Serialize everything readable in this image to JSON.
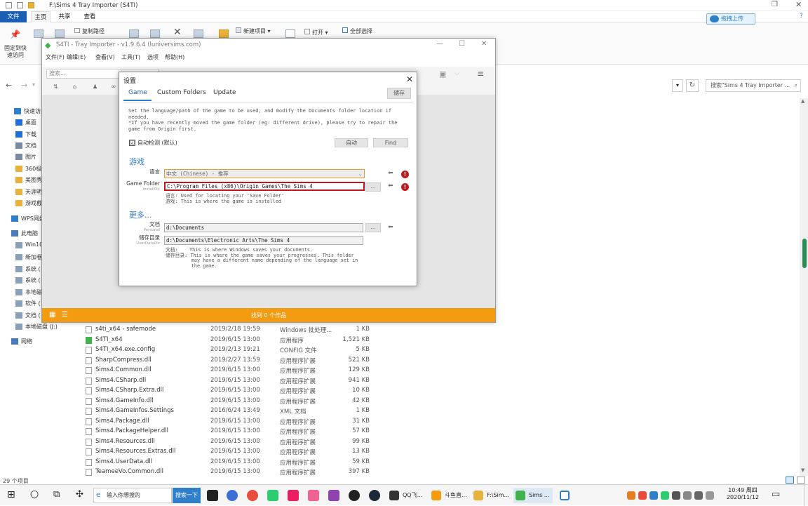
{
  "explorer": {
    "title": "F:\\Sims 4 Tray Importer (S4TI)",
    "tabs": [
      "文件",
      "主页",
      "共享",
      "查看"
    ],
    "ribbon": {
      "pin_label": "固定到快速访问",
      "copy_path": "复制路径",
      "new_item": "新建项目",
      "open": "打开",
      "select_all": "全部选择"
    },
    "upload_label": "拖拽上传",
    "search_placeholder": "搜索\"Sims 4 Tray Importer ...",
    "nav": [
      {
        "label": "快速访问",
        "icon": "star-icon",
        "color": "#2f7ec9"
      },
      {
        "label": "桌面",
        "icon": "desktop-icon",
        "color": "#1e6fd9"
      },
      {
        "label": "下载",
        "icon": "download-icon",
        "color": "#1e6fd9"
      },
      {
        "label": "文档",
        "icon": "document-icon",
        "color": "#7a8aa0"
      },
      {
        "label": "图片",
        "icon": "picture-icon",
        "color": "#7a8aa0"
      },
      {
        "label": "360极",
        "icon": "folder-icon",
        "color": "#e8b23a"
      },
      {
        "label": "美图秀",
        "icon": "folder-icon",
        "color": "#e8b23a"
      },
      {
        "label": "天涯明",
        "icon": "folder-icon",
        "color": "#e8b23a"
      },
      {
        "label": "游戏截",
        "icon": "folder-icon",
        "color": "#e8b23a"
      },
      {
        "label": "WPS网盘",
        "icon": "cloud-icon",
        "color": "#2f7ec9"
      },
      {
        "label": "此电脑",
        "icon": "computer-icon",
        "color": "#4a7ab8"
      },
      {
        "label": "Win10",
        "icon": "drive-icon",
        "color": "#8aa0b8"
      },
      {
        "label": "新加卷",
        "icon": "drive-icon",
        "color": "#8aa0b8"
      },
      {
        "label": "系统 (",
        "icon": "drive-icon",
        "color": "#8aa0b8"
      },
      {
        "label": "系统 (",
        "icon": "drive-icon",
        "color": "#8aa0b8"
      },
      {
        "label": "本地磁",
        "icon": "drive-icon",
        "color": "#8aa0b8"
      },
      {
        "label": "软件 (",
        "icon": "drive-icon",
        "color": "#8aa0b8"
      },
      {
        "label": "文档 (",
        "icon": "drive-icon",
        "color": "#8aa0b8"
      },
      {
        "label": "本地磁盘 (J:)",
        "icon": "drive-icon",
        "color": "#8aa0b8"
      },
      {
        "label": "网络",
        "icon": "network-icon",
        "color": "#4a7ab8"
      }
    ],
    "files": [
      {
        "name": "s4ti_x64 - safemode",
        "date": "2019/2/18 19:59",
        "type": "Windows 批处理...",
        "size": "1 KB"
      },
      {
        "name": "S4TI_x64",
        "date": "2019/6/15 13:00",
        "type": "应用程序",
        "size": "1,521 KB"
      },
      {
        "name": "S4TI_x64.exe.config",
        "date": "2019/2/13 19:21",
        "type": "CONFIG 文件",
        "size": "5 KB"
      },
      {
        "name": "SharpCompress.dll",
        "date": "2019/2/27 13:59",
        "type": "应用程序扩展",
        "size": "521 KB"
      },
      {
        "name": "Sims4.Common.dll",
        "date": "2019/6/15 13:00",
        "type": "应用程序扩展",
        "size": "129 KB"
      },
      {
        "name": "Sims4.CSharp.dll",
        "date": "2019/6/15 13:00",
        "type": "应用程序扩展",
        "size": "941 KB"
      },
      {
        "name": "Sims4.CSharp.Extra.dll",
        "date": "2019/6/15 13:00",
        "type": "应用程序扩展",
        "size": "10 KB"
      },
      {
        "name": "Sims4.GameInfo.dll",
        "date": "2019/6/15 13:00",
        "type": "应用程序扩展",
        "size": "42 KB"
      },
      {
        "name": "Sims4.GameInfos.Settings",
        "date": "2016/6/24 13:49",
        "type": "XML 文档",
        "size": "1 KB"
      },
      {
        "name": "Sims4.Package.dll",
        "date": "2019/6/15 13:00",
        "type": "应用程序扩展",
        "size": "31 KB"
      },
      {
        "name": "Sims4.PackageHelper.dll",
        "date": "2019/6/15 13:00",
        "type": "应用程序扩展",
        "size": "57 KB"
      },
      {
        "name": "Sims4.Resources.dll",
        "date": "2019/6/15 13:00",
        "type": "应用程序扩展",
        "size": "99 KB"
      },
      {
        "name": "Sims4.Resources.Extras.dll",
        "date": "2019/6/15 13:00",
        "type": "应用程序扩展",
        "size": "13 KB"
      },
      {
        "name": "Sims4.UserData.dll",
        "date": "2019/6/15 13:00",
        "type": "应用程序扩展",
        "size": "59 KB"
      },
      {
        "name": "TeameeVo.Common.dll",
        "date": "2019/6/15 13:00",
        "type": "应用程序扩展",
        "size": "397 KB"
      }
    ],
    "item_count": "29 个项目"
  },
  "s4ti": {
    "title": "S4TI - Tray Importer - v1.9.6.4  (luniversims.com)",
    "menu": [
      "文件(F)",
      "编辑(E)",
      "查看(V)",
      "工具(T)",
      "选项",
      "帮助(H)"
    ],
    "search_placeholder": "搜索...",
    "status": "找到 0 个作品"
  },
  "settings": {
    "title": "设置",
    "tabs": [
      "Game",
      "Custom Folders",
      "Update"
    ],
    "save_label": "储存",
    "description": "Set the language/path of the game to be used, and modify the Documents folder location if needed.\n*If you have recently moved the game folder (eg: different drive), please try to repair the game from Origin first.",
    "auto_detect_label": "自动检测 (默认)",
    "auto_detect_checked": "☑",
    "auto_button": "自动",
    "find_button": "Find",
    "game_section": "游戏",
    "language_label": "语言",
    "language_value": "中文          (Chinese)  - 推荐",
    "game_folder_label": "Game Folder",
    "game_folder_sub": "InstallDir",
    "game_folder_value": "C:\\Program Files (x86)\\Origin Games\\The Sims 4",
    "game_hint": "语言: Used for locating your 'Save Folder'\n游戏: This is where the game is installed",
    "more_section": "更多...",
    "documents_label": "文档",
    "documents_sub": "Personal",
    "documents_value": "d:\\Documents",
    "save_dir_label": "储存目录",
    "save_dir_sub": "UserDataDir",
    "save_dir_value": "d:\\Documents\\Electronic Arts\\The Sims 4",
    "more_hint": "文档:    This is where Windows saves your documents.\n储存目录: This is where the game saves your progresses. This folder\n         may have a different name depending of the language set in\n         the game.",
    "browse_label": "...",
    "arrow_label": "⬅",
    "warn_label": "!"
  },
  "taskbar": {
    "search_text": "输入你想搜的",
    "search_button": "搜索一下",
    "apps": [
      {
        "label": "QQ飞...",
        "icon": "qq-icon",
        "color": "#333"
      },
      {
        "label": "斗鱼直...",
        "icon": "douyu-icon",
        "color": "#f39c12"
      },
      {
        "label": "F:\\Sim...",
        "icon": "folder-icon",
        "color": "#e8b23a"
      },
      {
        "label": "Sims ...",
        "icon": "sims-icon",
        "color": "#3fb24b"
      }
    ],
    "time": "10:49 周四",
    "date": "2020/11/12"
  },
  "colors": {
    "accent": "#f39c12",
    "link": "#2f7ec9",
    "error": "#c0171d"
  }
}
